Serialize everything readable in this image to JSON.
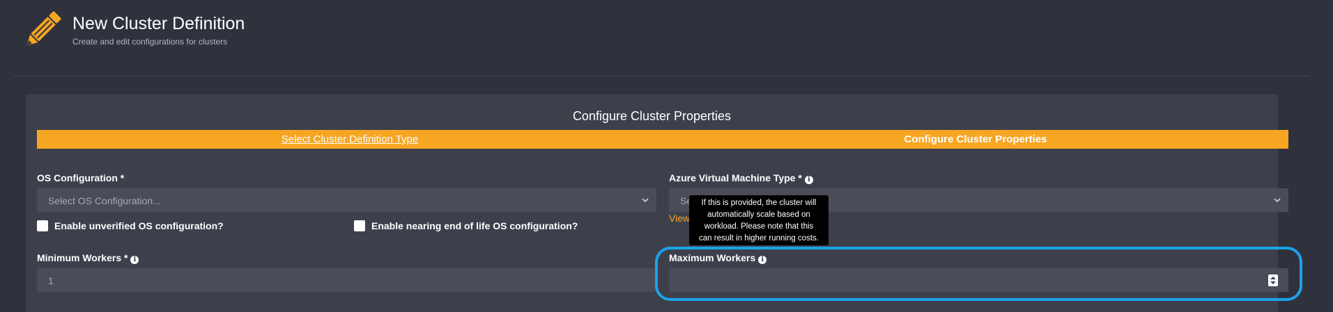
{
  "header": {
    "title": "New Cluster Definition",
    "subtitle": "Create and edit configurations for clusters",
    "icon": "pencil-icon",
    "icon_color": "#f6a623"
  },
  "panel": {
    "title": "Configure Cluster Properties",
    "steps": [
      {
        "label": "Select Cluster Definition Type",
        "state": "link"
      },
      {
        "label": "Configure Cluster Properties",
        "state": "active"
      }
    ],
    "accent": "#f6a623"
  },
  "form": {
    "os_config": {
      "label": "OS Configuration *",
      "placeholder": "Select OS Configuration..."
    },
    "vm_type": {
      "label": "Azure Virtual Machine Type *",
      "placeholder": "Se",
      "link_text": "View"
    },
    "unverified_os": {
      "label": "Enable unverified OS configuration?",
      "checked": false
    },
    "eol_os": {
      "label": "Enable nearing end of life OS configuration?",
      "checked": false
    },
    "min_workers": {
      "label": "Minimum Workers *",
      "value": "1"
    },
    "max_workers": {
      "label": "Maximum Workers",
      "value": ""
    }
  },
  "tooltip": {
    "lines": [
      "If this is provided, the cluster will",
      "automatically scale based on",
      "workload. Please note that this",
      "can result in higher running costs."
    ]
  },
  "highlight_color": "#1aa3e8"
}
